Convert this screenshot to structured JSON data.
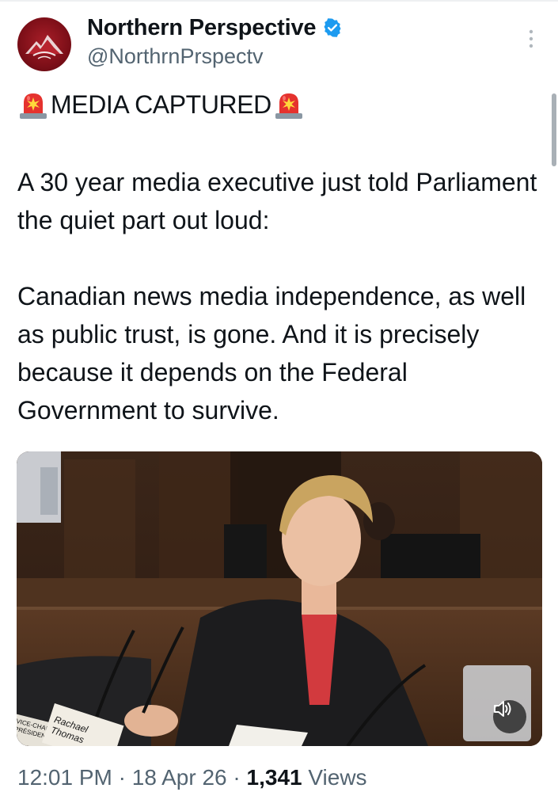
{
  "author": {
    "display_name": "Northern Perspective",
    "handle": "@NorthrnPrspectv",
    "avatar_icon": "mountain-logo-icon",
    "verified_icon": "verified-badge-icon",
    "verified_color": "#1d9bf0"
  },
  "menu": {
    "icon": "more-options-icon"
  },
  "tweet": {
    "headline_icon": "police-siren-icon",
    "headline": "MEDIA CAPTURED",
    "paragraph1": "A 30 year media executive just told Parliament the quiet part out loud:",
    "paragraph2": "Canadian news media independence, as well as public trust,  is gone. And it is precisely because it depends on the Federal Government to survive."
  },
  "media": {
    "name_card": "Rachael Thomas",
    "name_card_small": "VICE-CHAIR PRÉSIDENT",
    "mute_icon": "speaker-mute-icon"
  },
  "meta": {
    "time": "12:01 PM",
    "separator": "·",
    "date": "18 Apr 26",
    "views_count": "1,341",
    "views_label": "Views"
  }
}
